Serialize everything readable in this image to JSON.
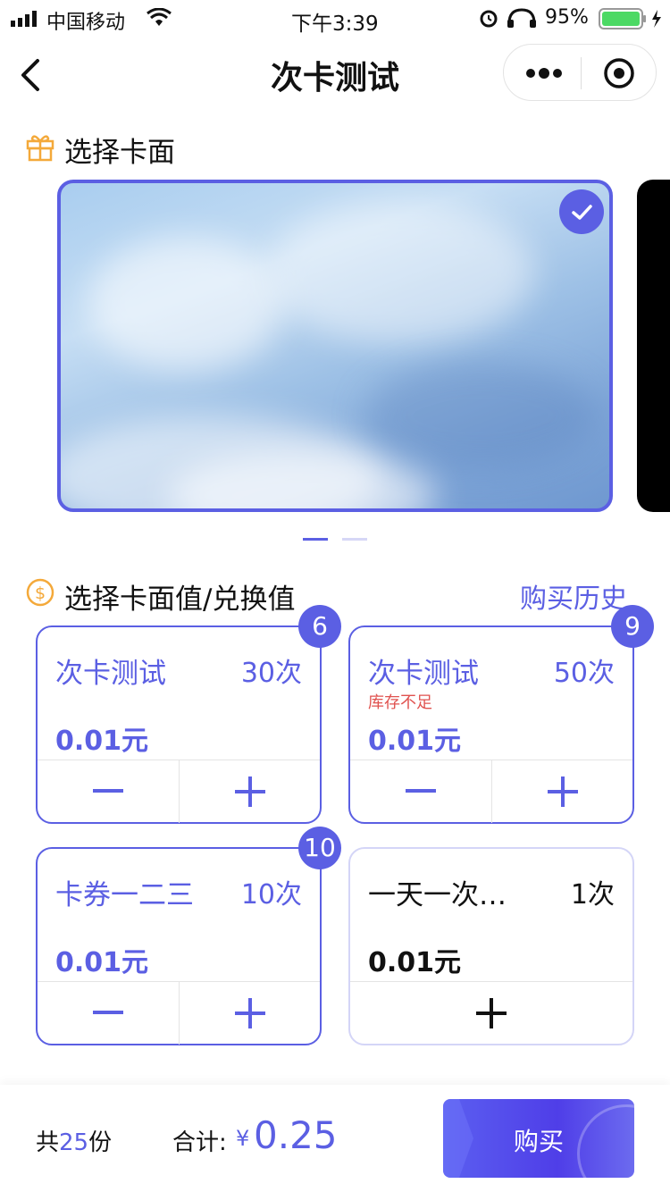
{
  "status_bar": {
    "carrier": "中国移动",
    "time": "下午3:39",
    "battery_pct": "95%"
  },
  "nav": {
    "title": "次卡测试"
  },
  "card_section": {
    "title": "选择卡面"
  },
  "value_section": {
    "title": "选择卡面值/兑换值",
    "history_link": "购买历史"
  },
  "value_cards": [
    {
      "name": "次卡测试",
      "count": "30次",
      "price": "0.01元",
      "badge": "6",
      "warning": ""
    },
    {
      "name": "次卡测试",
      "count": "50次",
      "price": "0.01元",
      "badge": "9",
      "warning": "库存不足"
    },
    {
      "name": "卡券一二三",
      "count": "10次",
      "price": "0.01元",
      "badge": "10",
      "warning": ""
    },
    {
      "name": "一天一次…",
      "count": "1次",
      "price": "0.01元",
      "badge": "",
      "warning": ""
    }
  ],
  "summary": {
    "count_prefix": "共",
    "count_num": "25",
    "count_suffix": "份",
    "sum_label": "合计:",
    "currency": "¥",
    "sum_value": "0.25",
    "buy_label": "购买"
  },
  "colors": {
    "accent": "#5b5fe3",
    "warning": "#e0524f",
    "battery": "#4cd964",
    "icon_orange": "#f4a93a"
  }
}
